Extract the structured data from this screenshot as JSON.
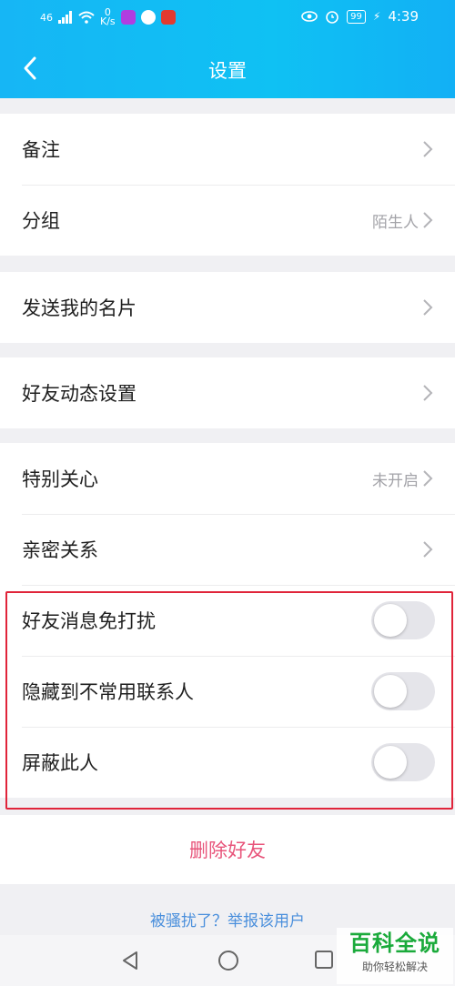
{
  "status_bar": {
    "signal_text": "46",
    "speed_value": "0",
    "speed_unit": "K/s",
    "battery": "99",
    "time": "4:39"
  },
  "header": {
    "title": "设置"
  },
  "groups": [
    {
      "rows": [
        {
          "label": "备注",
          "value": ""
        },
        {
          "label": "分组",
          "value": "陌生人"
        }
      ]
    },
    {
      "rows": [
        {
          "label": "发送我的名片",
          "value": ""
        }
      ]
    },
    {
      "rows": [
        {
          "label": "好友动态设置",
          "value": ""
        }
      ]
    },
    {
      "rows": [
        {
          "label": "特别关心",
          "value": "未开启"
        },
        {
          "label": "亲密关系",
          "value": ""
        }
      ]
    }
  ],
  "toggles": [
    {
      "label": "好友消息免打扰",
      "on": false
    },
    {
      "label": "隐藏到不常用联系人",
      "on": false
    },
    {
      "label": "屏蔽此人",
      "on": false
    }
  ],
  "delete_label": "删除好友",
  "report_link": "被骚扰了？举报该用户",
  "watermark": {
    "title": "百科全说",
    "subtitle": "助你轻松解决"
  },
  "colors": {
    "header_blue": "#12b8f5",
    "delete_pink": "#e8557b",
    "link_blue": "#4a8fdc",
    "highlight_red": "#e0243a"
  }
}
